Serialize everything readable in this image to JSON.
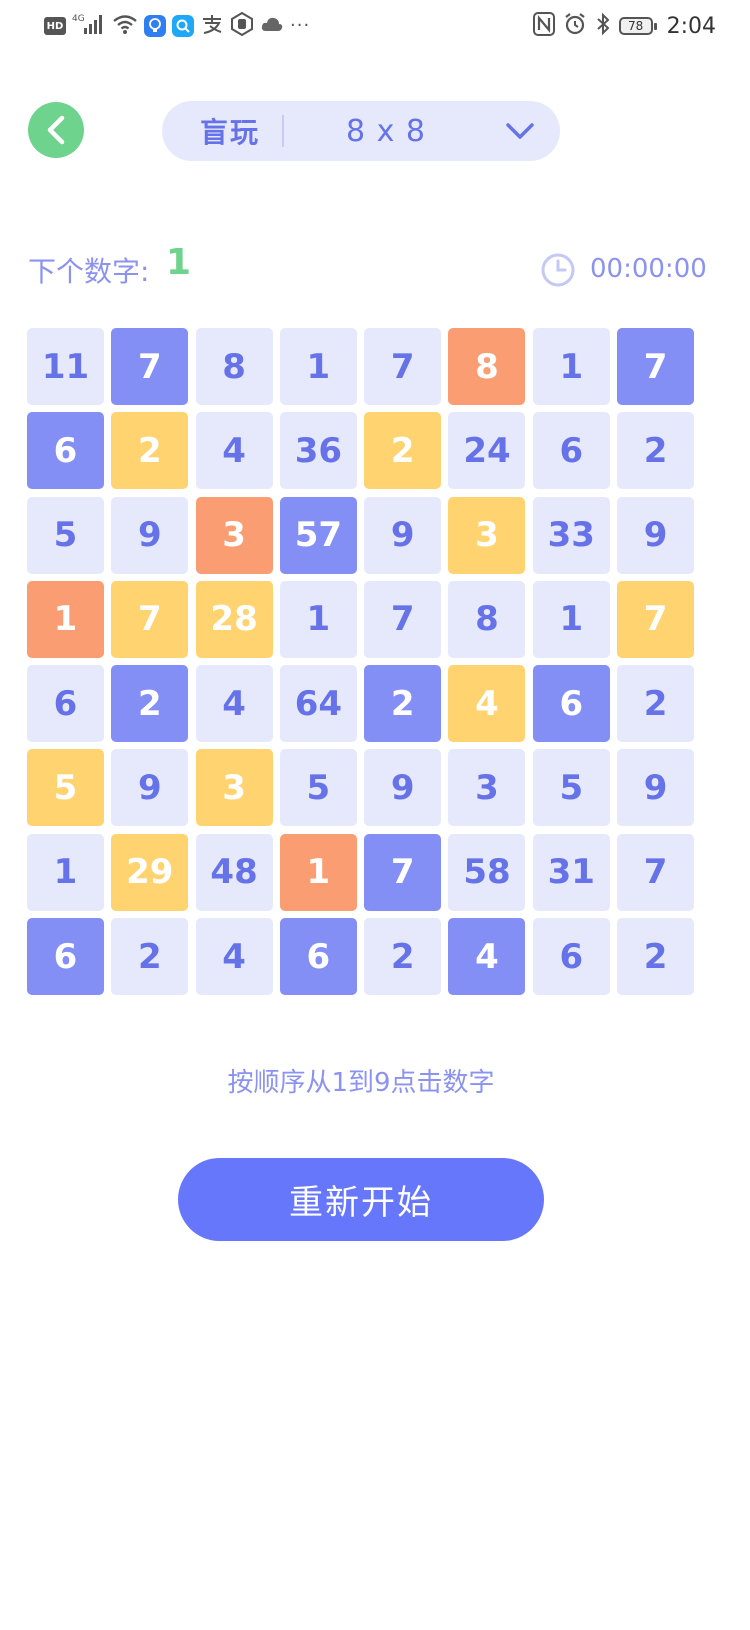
{
  "status_bar": {
    "hd": "HD",
    "signal": "4G",
    "app_icons": [
      "bulb-icon",
      "search-icon",
      "alipay-icon",
      "hand-icon",
      "cloud-icon"
    ],
    "battery": "78",
    "time": "2:04"
  },
  "header": {
    "mode_label": "盲玩",
    "grid_size": "8 x 8"
  },
  "progress": {
    "next_label": "下个数字:",
    "next_value": "1",
    "timer": "00:00:00"
  },
  "colors": {
    "light": "#e6e9fb",
    "blue": "#838ff5",
    "yellow": "#ffd36f",
    "orange": "#fb9d72",
    "green": "#6ed38c",
    "accent": "#6677fb"
  },
  "grid": {
    "rows": [
      [
        {
          "v": "11",
          "c": "light"
        },
        {
          "v": "7",
          "c": "blue"
        },
        {
          "v": "8",
          "c": "light"
        },
        {
          "v": "1",
          "c": "light"
        },
        {
          "v": "7",
          "c": "light"
        },
        {
          "v": "8",
          "c": "orange"
        },
        {
          "v": "1",
          "c": "light"
        },
        {
          "v": "7",
          "c": "blue"
        }
      ],
      [
        {
          "v": "6",
          "c": "blue"
        },
        {
          "v": "2",
          "c": "yellow"
        },
        {
          "v": "4",
          "c": "light"
        },
        {
          "v": "36",
          "c": "light"
        },
        {
          "v": "2",
          "c": "yellow"
        },
        {
          "v": "24",
          "c": "light"
        },
        {
          "v": "6",
          "c": "light"
        },
        {
          "v": "2",
          "c": "light"
        }
      ],
      [
        {
          "v": "5",
          "c": "light"
        },
        {
          "v": "9",
          "c": "light"
        },
        {
          "v": "3",
          "c": "orange"
        },
        {
          "v": "57",
          "c": "blue"
        },
        {
          "v": "9",
          "c": "light"
        },
        {
          "v": "3",
          "c": "yellow"
        },
        {
          "v": "33",
          "c": "light"
        },
        {
          "v": "9",
          "c": "light"
        }
      ],
      [
        {
          "v": "1",
          "c": "orange"
        },
        {
          "v": "7",
          "c": "yellow"
        },
        {
          "v": "28",
          "c": "yellow"
        },
        {
          "v": "1",
          "c": "light"
        },
        {
          "v": "7",
          "c": "light"
        },
        {
          "v": "8",
          "c": "light"
        },
        {
          "v": "1",
          "c": "light"
        },
        {
          "v": "7",
          "c": "yellow"
        }
      ],
      [
        {
          "v": "6",
          "c": "light"
        },
        {
          "v": "2",
          "c": "blue"
        },
        {
          "v": "4",
          "c": "light"
        },
        {
          "v": "64",
          "c": "light"
        },
        {
          "v": "2",
          "c": "blue"
        },
        {
          "v": "4",
          "c": "yellow"
        },
        {
          "v": "6",
          "c": "blue"
        },
        {
          "v": "2",
          "c": "light"
        }
      ],
      [
        {
          "v": "5",
          "c": "yellow"
        },
        {
          "v": "9",
          "c": "light"
        },
        {
          "v": "3",
          "c": "yellow"
        },
        {
          "v": "5",
          "c": "light"
        },
        {
          "v": "9",
          "c": "light"
        },
        {
          "v": "3",
          "c": "light"
        },
        {
          "v": "5",
          "c": "light"
        },
        {
          "v": "9",
          "c": "light"
        }
      ],
      [
        {
          "v": "1",
          "c": "light"
        },
        {
          "v": "29",
          "c": "yellow"
        },
        {
          "v": "48",
          "c": "light"
        },
        {
          "v": "1",
          "c": "orange"
        },
        {
          "v": "7",
          "c": "blue"
        },
        {
          "v": "58",
          "c": "light"
        },
        {
          "v": "31",
          "c": "light"
        },
        {
          "v": "7",
          "c": "light"
        }
      ],
      [
        {
          "v": "6",
          "c": "blue"
        },
        {
          "v": "2",
          "c": "light"
        },
        {
          "v": "4",
          "c": "light"
        },
        {
          "v": "6",
          "c": "blue"
        },
        {
          "v": "2",
          "c": "light"
        },
        {
          "v": "4",
          "c": "blue"
        },
        {
          "v": "6",
          "c": "light"
        },
        {
          "v": "2",
          "c": "light"
        }
      ]
    ]
  },
  "footer": {
    "hint": "按顺序从1到9点击数字",
    "restart_label": "重新开始"
  }
}
